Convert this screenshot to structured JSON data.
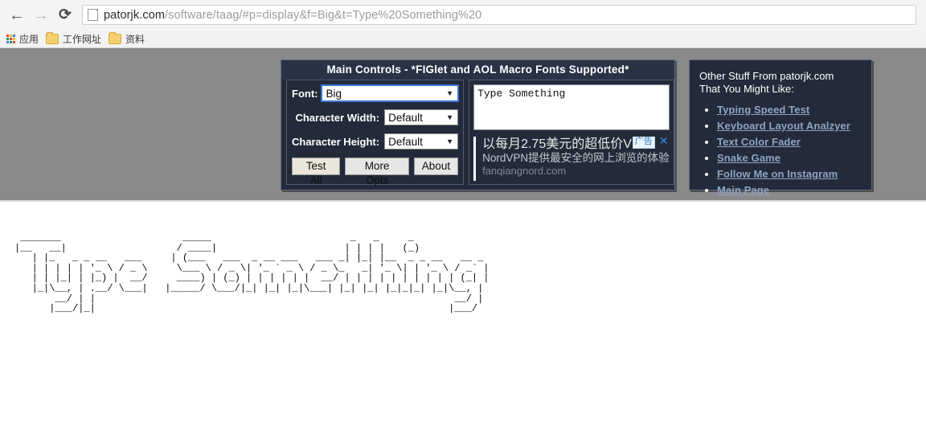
{
  "browser": {
    "back_icon": "back-arrow-icon",
    "forward_icon": "forward-arrow-icon",
    "reload_icon": "reload-icon",
    "url_host": "patorjk.com",
    "url_path": "/software/taag/#p=display&f=Big&t=Type%20Something%20",
    "bookmarks": [
      {
        "label": "应用",
        "icon": "apps-grid-icon"
      },
      {
        "label": "工作网址",
        "icon": "folder-icon"
      },
      {
        "label": "资料",
        "icon": "folder-icon"
      }
    ]
  },
  "main_controls": {
    "title": "Main Controls - *FIGlet and AOL Macro Fonts Supported*",
    "font_label": "Font:",
    "font_value": "Big",
    "char_width_label": "Character Width:",
    "char_width_value": "Default",
    "char_height_label": "Character Height:",
    "char_height_value": "Default",
    "buttons": {
      "test_all": "Test All",
      "more_opts": "More Opts",
      "about": "About"
    },
    "textarea_value": "Type Something",
    "textarea_placeholder": "Type Something"
  },
  "ad": {
    "line1": "以每月2.75美元的超低价VPN",
    "line2": "NordVPN提供最安全的网上浏览的体验",
    "line3": "fanqiangnord.com",
    "badge": "广告",
    "close": "✕"
  },
  "other_stuff": {
    "heading_line1": "Other Stuff From patorjk.com",
    "heading_line2": "That You Might Like:",
    "links": [
      "Typing Speed Test",
      "Keyboard Layout Analzyer",
      "Text Color Fader",
      "Snake Game",
      "Follow Me on Instagram",
      "Main Page"
    ]
  },
  "output": {
    "ascii_art": " _______                     _____                        _   _     _                \n|__   __|                   / ____|                      | | | |   (_)               \n   | |_   _ _ __   ___     | (___   ___  _ __ ___   ___ _| |_| |__  _ _ __   __ _   \n   | | | | | '_ \\ / _ \\     \\___ \\ / _ \\| '_ ` _ \\ / _ \\_   _| '_ \\| | '_ \\ / _` |  \n   | | |_| | |_) |  __/     ____) | (_) | | | | | |  __/ | | | | | | | | | | (_| |  \n   |_|\\__, | .__/ \\___|   |_____/ \\___/|_| |_| |_|\\___| |_| |_| |_|_|_| |_|\\__, |  \n       __/ | |                                                              __/ |  \n      |___/|_|                                                             |___/   "
  },
  "colors": {
    "page_bg": "#898989",
    "panel_bg": "#232b3a",
    "panel_border": "#5f6b80",
    "link": "#8ea3c4",
    "focus": "#3b76d8"
  }
}
